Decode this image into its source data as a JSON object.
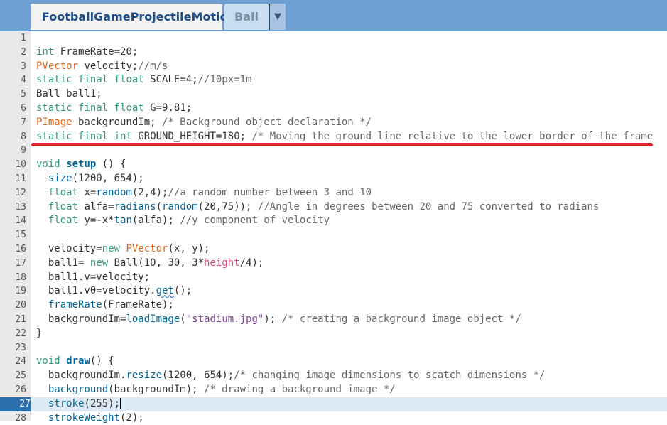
{
  "tabs": {
    "active": "FootballGameProjectileMotion",
    "inactive": "Ball",
    "menu_arrow": "▼"
  },
  "colors": {
    "topbar": "#6ea0d3",
    "highlight_line": "#dde9f5",
    "annotation": "#d9232e"
  },
  "editor": {
    "current_line": "27",
    "lines": [
      {
        "n": "1",
        "code": ""
      },
      {
        "n": "2",
        "code": "int FrameRate=20;"
      },
      {
        "n": "3",
        "code": "PVector velocity;//m/s"
      },
      {
        "n": "4",
        "code": "static final float SCALE=4;//10px=1m"
      },
      {
        "n": "5",
        "code": "Ball ball1;"
      },
      {
        "n": "6",
        "code": "static final float G=9.81;"
      },
      {
        "n": "7",
        "code": "PImage backgroundIm; /* Background object declaration */"
      },
      {
        "n": "8",
        "code": "static final int GROUND_HEIGHT=180; /* Moving the ground line relative to the lower border of the frame"
      },
      {
        "n": "9",
        "code": ""
      },
      {
        "n": "10",
        "code": "void setup () {"
      },
      {
        "n": "11",
        "code": "  size(1200, 654);"
      },
      {
        "n": "12",
        "code": "  float x=random(2,4);//a random number between 3 and 10"
      },
      {
        "n": "13",
        "code": "  float alfa=radians(random(20,75)); //Angle in degrees between 20 and 75 converted to radians"
      },
      {
        "n": "14",
        "code": "  float y=-x*tan(alfa); //y component of velocity"
      },
      {
        "n": "15",
        "code": ""
      },
      {
        "n": "16",
        "code": "  velocity=new PVector(x, y);"
      },
      {
        "n": "17",
        "code": "  ball1= new Ball(10, 30, 3*height/4);"
      },
      {
        "n": "18",
        "code": "  ball1.v=velocity;"
      },
      {
        "n": "19",
        "code": "  ball1.v0=velocity.get();"
      },
      {
        "n": "20",
        "code": "  frameRate(FrameRate);"
      },
      {
        "n": "21",
        "code": "  backgroundIm=loadImage(\"stadium.jpg\"); /* creating a background image object */"
      },
      {
        "n": "22",
        "code": "}"
      },
      {
        "n": "23",
        "code": ""
      },
      {
        "n": "24",
        "code": "void draw() {"
      },
      {
        "n": "25",
        "code": "  backgroundIm.resize(1200, 654);/* changing image dimensions to scatch dimensions */"
      },
      {
        "n": "26",
        "code": "  background(backgroundIm); /* drawing a background image */"
      },
      {
        "n": "27",
        "code": "  stroke(255);"
      },
      {
        "n": "28",
        "code": "  strokeWeight(2);"
      }
    ]
  }
}
